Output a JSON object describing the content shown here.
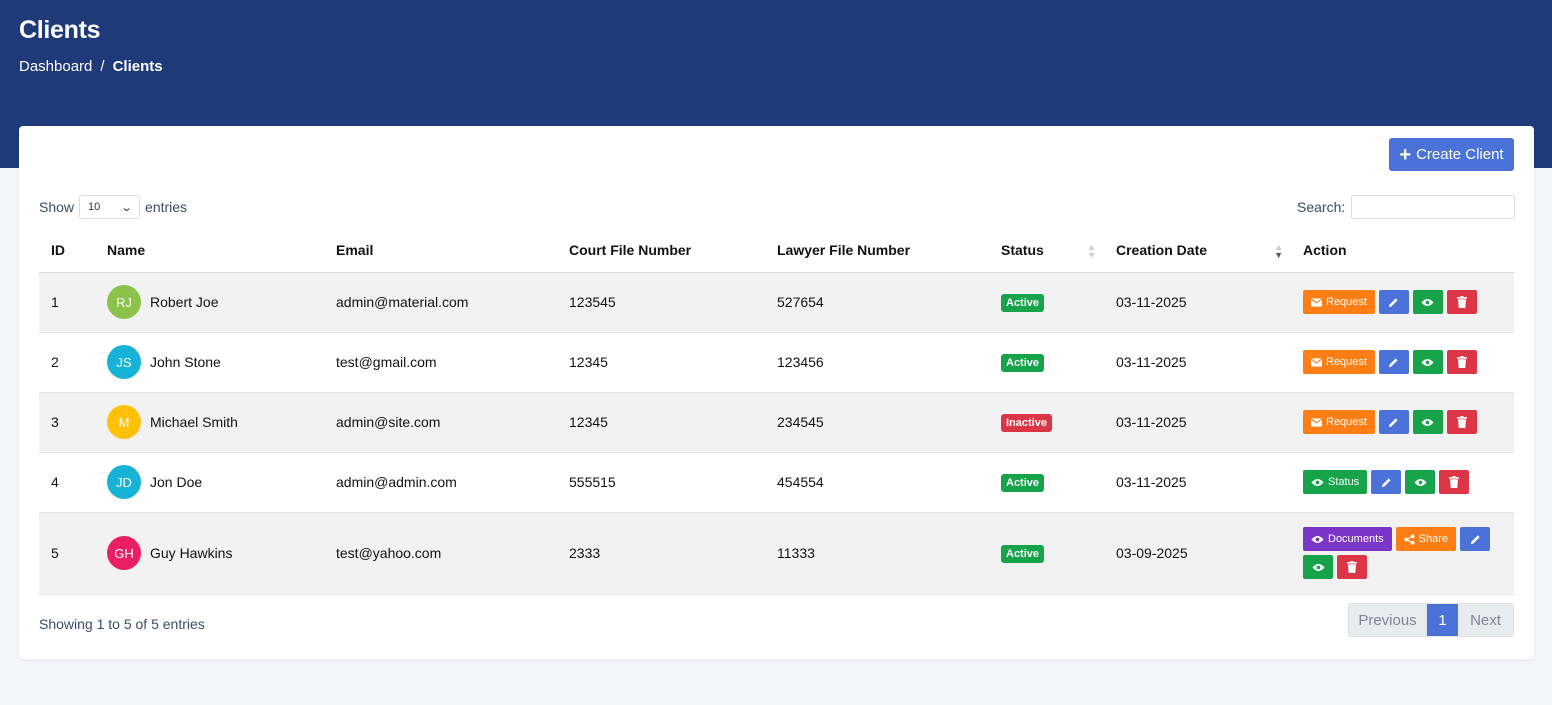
{
  "header": {
    "title": "Clients",
    "breadcrumb": {
      "home": "Dashboard",
      "separator": "/",
      "current": "Clients"
    }
  },
  "toolbar": {
    "create_label": "Create Client"
  },
  "length_control": {
    "prefix": "Show",
    "value": "10",
    "suffix": "entries"
  },
  "search": {
    "label": "Search:",
    "value": "",
    "placeholder": ""
  },
  "table": {
    "columns": [
      "ID",
      "Name",
      "Email",
      "Court File Number",
      "Lawyer File Number",
      "Status",
      "Creation Date",
      "Action"
    ],
    "rows": [
      {
        "id": "1",
        "initials": "RJ",
        "avatar_color": "#8bc34a",
        "name": "Robert Joe",
        "email": "admin@material.com",
        "court": "123545",
        "lawyer": "527654",
        "status": "Active",
        "date": "03-11-2025"
      },
      {
        "id": "2",
        "initials": "JS",
        "avatar_color": "#17b3d6",
        "name": "John Stone",
        "email": "test@gmail.com",
        "court": "12345",
        "lawyer": "123456",
        "status": "Active",
        "date": "03-11-2025"
      },
      {
        "id": "3",
        "initials": "M",
        "avatar_color": "#ffc107",
        "name": "Michael Smith",
        "email": "admin@site.com",
        "court": "12345",
        "lawyer": "234545",
        "status": "Inactive",
        "date": "03-11-2025"
      },
      {
        "id": "4",
        "initials": "JD",
        "avatar_color": "#17b3d6",
        "name": "Jon Doe",
        "email": "admin@admin.com",
        "court": "555515",
        "lawyer": "454554",
        "status": "Active",
        "date": "03-11-2025"
      },
      {
        "id": "5",
        "initials": "GH",
        "avatar_color": "#e91e63",
        "name": "Guy Hawkins",
        "email": "test@yahoo.com",
        "court": "2333",
        "lawyer": "11333",
        "status": "Active",
        "date": "03-09-2025"
      }
    ]
  },
  "action_labels": {
    "request": "Request",
    "status": "Status",
    "documents": "Documents",
    "share": "Share"
  },
  "footer": {
    "info": "Showing 1 to 5 of 5 entries",
    "previous": "Previous",
    "page": "1",
    "next": "Next"
  },
  "colors": {
    "banner": "#1f3a78",
    "primary": "#4a72d8",
    "active": "#16a34a",
    "inactive": "#dc3545",
    "request": "#fd7e14",
    "documents": "#7b35c9"
  },
  "icons": {
    "create": "plus-icon",
    "request": "envelope-icon",
    "edit": "pencil-icon",
    "view": "eye-icon",
    "delete": "trash-icon",
    "share": "share-icon"
  }
}
